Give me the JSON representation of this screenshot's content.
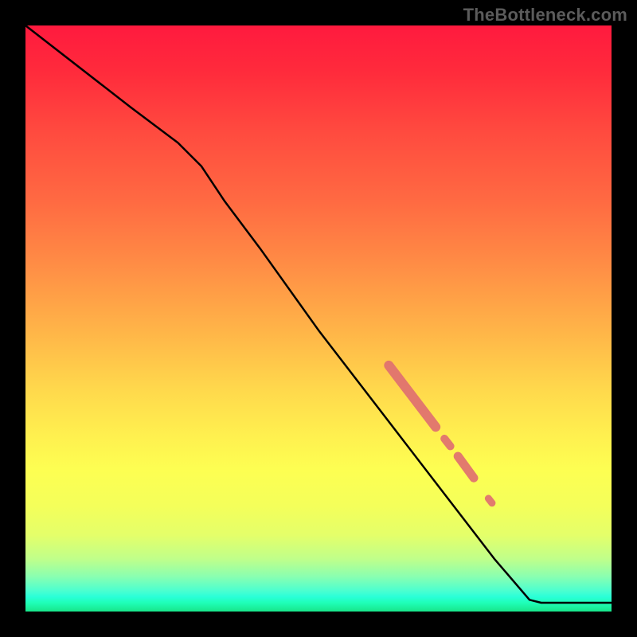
{
  "watermark": "TheBottleneck.com",
  "colors": {
    "curve": "#000000",
    "marker": "#e07070",
    "background": "#000000"
  },
  "chart_data": {
    "type": "line",
    "title": "",
    "xlabel": "",
    "ylabel": "",
    "xlim": [
      0,
      100
    ],
    "ylim": [
      0,
      100
    ],
    "grid": false,
    "curve": [
      {
        "x": 0,
        "y": 100
      },
      {
        "x": 18,
        "y": 86
      },
      {
        "x": 26,
        "y": 80
      },
      {
        "x": 30,
        "y": 76
      },
      {
        "x": 34,
        "y": 70
      },
      {
        "x": 40,
        "y": 62
      },
      {
        "x": 50,
        "y": 48
      },
      {
        "x": 60,
        "y": 35
      },
      {
        "x": 70,
        "y": 22
      },
      {
        "x": 80,
        "y": 9
      },
      {
        "x": 86,
        "y": 2
      },
      {
        "x": 88,
        "y": 1.5
      },
      {
        "x": 100,
        "y": 1.5
      }
    ],
    "marker_segments": [
      {
        "x0": 62,
        "y0": 42,
        "x1": 70,
        "y1": 31.5,
        "r": 6
      },
      {
        "x0": 71.5,
        "y0": 29.5,
        "x1": 72.5,
        "y1": 28.2,
        "r": 5
      },
      {
        "x0": 73.8,
        "y0": 26.5,
        "x1": 76.5,
        "y1": 22.8,
        "r": 5.5
      },
      {
        "x0": 79,
        "y0": 19.3,
        "x1": 79.6,
        "y1": 18.5,
        "r": 4.5
      }
    ]
  }
}
